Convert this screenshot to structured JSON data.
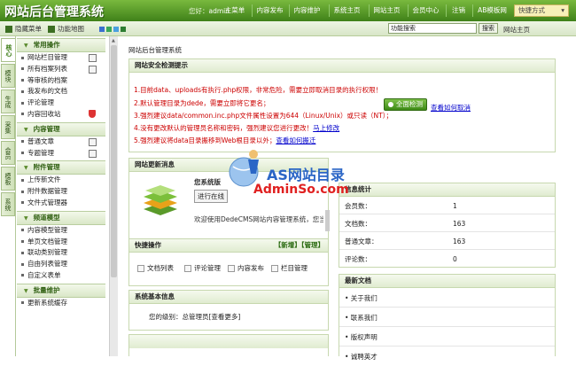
{
  "header": {
    "logo": "网站后台管理系统",
    "greeting_prefix": "您好：",
    "user": "admin",
    "nav": [
      "主菜单",
      "内容发布",
      "内容维护",
      "系统主页",
      "网站主页",
      "会员中心",
      "注销",
      "AB模板网"
    ],
    "quick_label": "快捷方式",
    "quick_arrow": "▾"
  },
  "subbar": {
    "hide_menu": "隐藏菜单",
    "function_map": "功能地图",
    "swatch_colors": [
      "#3b6fd0",
      "#3aa75a",
      "#4aa0e0",
      "#2e7d32"
    ],
    "search_value": "功能搜索",
    "search_button": "搜索",
    "site_main": "网站主页"
  },
  "vtabs": [
    "核心",
    "模块",
    "生成",
    "采集",
    "会员",
    "模板",
    "系统"
  ],
  "menu": [
    {
      "title": "常用操作",
      "items": [
        "网站栏目管理",
        "所有档案列表",
        "等审核的档案",
        "我发布的文档",
        "评论管理",
        "内容回收站"
      ]
    },
    {
      "title": "内容管理",
      "items": [
        "普通文章",
        "专题管理"
      ]
    },
    {
      "title": "附件管理",
      "items": [
        "上传新文件",
        "附件数据管理",
        "文件式管理器"
      ]
    },
    {
      "title": "频道模型",
      "items": [
        "内容模型管理",
        "单页文档管理",
        "联动类别管理",
        "自由列表管理",
        "自定义表单"
      ]
    },
    {
      "title": "批量维护",
      "items": [
        "更新系统缓存"
      ]
    }
  ],
  "main": {
    "crumb": "网站后台管理系统",
    "security": {
      "title": "网站安全检测提示",
      "warnings": [
        {
          "text": "1.目前data、uploads有执行.php权限，非常危险，需要立即取消目录的执行权限！",
          "link": ""
        },
        {
          "text": "2.默认管理目录为dede，需要立即将它更名；",
          "link": ""
        },
        {
          "text": "3.强烈建议data/common.inc.php文件属性设置为644（Linux/Unix）或只读（NT）；",
          "link": ""
        },
        {
          "text": "4.没有更改默认的管理员名称和密码，强烈建议您进行更改！",
          "link": "马上修改"
        },
        {
          "text": "5.强烈建议将data目录搬移到Web根目录以外；",
          "link": "查看如何搬迁"
        }
      ],
      "check_button": "全面检测",
      "check_link": "查看如何取消"
    },
    "update_panel": {
      "title": "网站更新消息",
      "system_label": "您系统版",
      "in_progress": "进行在线",
      "welcome": "欢迎使用DedeCMS网站内容管理系统，您当"
    },
    "stats": {
      "title": "信息统计",
      "rows": [
        {
          "label": "会员数：",
          "value": "1"
        },
        {
          "label": "文档数：",
          "value": "163"
        },
        {
          "label": "普通文章：",
          "value": "163"
        },
        {
          "label": "评论数：",
          "value": "0"
        }
      ]
    },
    "quick_ops": {
      "title": "快捷操作",
      "actions": "【新增】【管理】",
      "items": [
        "文档列表",
        "评论管理",
        "内容发布",
        "栏目管理"
      ]
    },
    "sysinfo": {
      "title": "系统基本信息",
      "level_label": "您的级别：",
      "level_value": "总管理员",
      "more": "[查看更多]"
    },
    "latest": {
      "title": "最新文档",
      "items": [
        "• 关于我们",
        "• 联系我们",
        "• 版权声明",
        "• 诚聘英才"
      ]
    }
  },
  "watermark": {
    "line1": "AS网站目录",
    "line2": "AdminSo.com"
  }
}
